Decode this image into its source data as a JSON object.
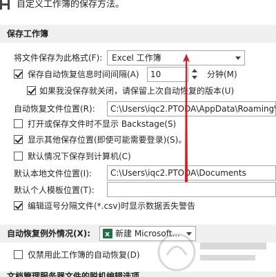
{
  "top": {
    "description": "自定义工作簿的保存方法。"
  },
  "section_save": {
    "title": "保存工作簿",
    "format_label": "将文件保存为此格式(F):",
    "format_value": "Excel 工作簿",
    "autorecover_label": "保存自动恢复信息时间间隔(A)",
    "autorecover_minutes": "10",
    "minutes_label": "分钟(M)",
    "keep_last_label": "如果我没保存就关闭，请保留上次自动恢复的版本(U)",
    "autorecover_location_label": "自动恢复文件位置(R):",
    "autorecover_location_value": "C:\\Users\\iqc2.PTODA\\AppData\\Roaming\\M",
    "no_backstage_label": "打开或保存文件时不显示 Backstage(S)",
    "show_other_locations_label": "显示其他保存位置(即使可能需要登录)(S)。",
    "default_computer_label": "默认情况下保存到计算机(C)",
    "default_local_label": "默认本地文件位置(I):",
    "default_local_value": "C:\\Users\\iqc2.PTODA\\Documents",
    "default_template_label": "默认个人模板位置(T):",
    "default_template_value": "",
    "csv_warning_label": "编辑逗号分隔文件(*.csv)时显示数据丢失警告"
  },
  "section_exceptions": {
    "title": "自动恢复例外情况(X):",
    "workbook_value": "新建 Microsoft...",
    "disable_autorecover_label": "仅禁用此工作簿的自动恢复(D)"
  },
  "section_cutoff": {
    "title": "文档管理服务器文件的脱机编辑选项"
  },
  "colors": {
    "section_bg": "#f0f0f0",
    "arrow_red": "#e0191f",
    "excel_green": "#1e7145"
  },
  "checkboxes": {
    "autorecover": true,
    "keep_last": true,
    "no_backstage": false,
    "show_other_locations": true,
    "default_computer": false,
    "csv_warning": true,
    "disable_autorecover": false
  }
}
